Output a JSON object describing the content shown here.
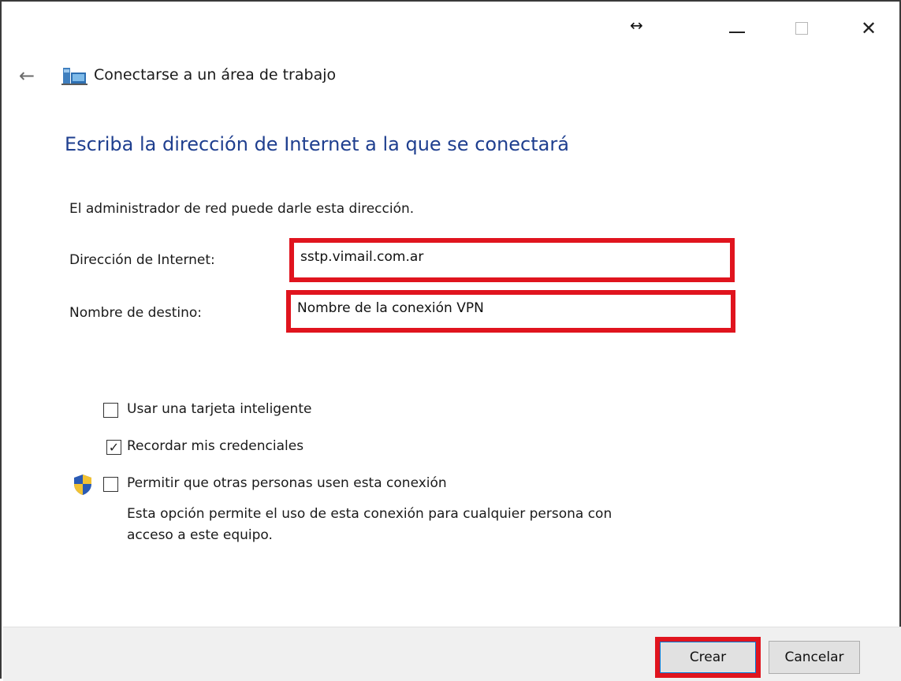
{
  "titlebar": {
    "resize_glyph": "↔",
    "close_glyph": "✕"
  },
  "nav": {
    "back_glyph": "←",
    "title": "Conectarse a un área de trabajo",
    "icon": "network-workplace-icon"
  },
  "main": {
    "heading": "Escriba la dirección de Internet a la que se conectará",
    "intro": "El administrador de red puede darle esta dirección.",
    "fields": {
      "url_label": "Dirección de Internet:",
      "url_value": "sstp.vimail.com.ar",
      "name_label": "Nombre de destino:",
      "name_value": "Nombre de la conexión VPN"
    },
    "options": {
      "smartcard": {
        "label": "Usar una tarjeta inteligente",
        "checked": false
      },
      "remember": {
        "label": "Recordar mis credenciales",
        "checked": true,
        "check_glyph": "✓"
      },
      "allow_others": {
        "label": "Permitir que otras personas usen esta conexión",
        "checked": false,
        "icon": "uac-shield-icon",
        "description": "Esta opción permite el uso de esta conexión para cualquier persona con acceso a este equipo."
      }
    }
  },
  "footer": {
    "create_label": "Crear",
    "cancel_label": "Cancelar"
  },
  "colors": {
    "heading": "#1f3f8f",
    "highlight": "#e0141e",
    "footer_bg": "#f0f0f0"
  }
}
